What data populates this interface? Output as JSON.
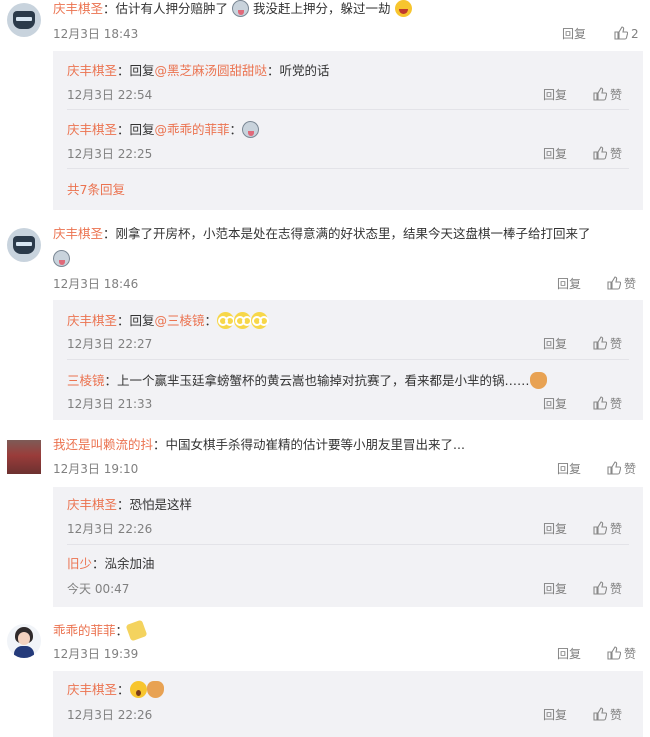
{
  "like_label": "赞",
  "reply_label": "回复",
  "comments": [
    {
      "name": "庆丰棋圣",
      "text_a": "估计有人押分赔肿了",
      "text_b": "我没赶上押分，躲过一劫",
      "time": "12月3日 18:43",
      "likes": "2",
      "replies": [
        {
          "name": "庆丰棋圣",
          "prefix": "：回复",
          "mention": "@黑芝麻汤圆甜甜哒",
          "text": "：听党的话",
          "time": "12月3日 22:54"
        },
        {
          "name": "庆丰棋圣",
          "prefix": "：回复",
          "mention": "@乖乖的菲菲",
          "text": "：",
          "time": "12月3日 22:25"
        }
      ],
      "more": "共7条回复"
    },
    {
      "name": "庆丰棋圣",
      "text": "：刚拿了开房杯，小范本是处在志得意满的好状态里，结果今天这盘棋一棒子给打回来了",
      "time": "12月3日 18:46",
      "replies": [
        {
          "name": "庆丰棋圣",
          "prefix": "：回复",
          "mention": "@三棱镜",
          "text": "：",
          "time": "12月3日 22:27"
        },
        {
          "name": "三棱镜",
          "text": "：上一个赢芈玉廷拿螃蟹杯的黄云嵩也输掉对抗赛了，看来都是小芈的锅……",
          "time": "12月3日 21:33"
        }
      ]
    },
    {
      "name": "我还是叫赖流的抖",
      "text": "：中国女棋手杀得动崔精的估计要等小朋友里冒出来了...",
      "time": "12月3日 19:10",
      "replies": [
        {
          "name": "庆丰棋圣",
          "text": "：恐怕是这样",
          "time": "12月3日 22:26"
        },
        {
          "name": "旧少",
          "text": "：泓余加油",
          "time": "今天 00:47"
        }
      ]
    },
    {
      "name": "乖乖的菲菲",
      "text": "：",
      "time": "12月3日 19:39",
      "replies": [
        {
          "name": "庆丰棋圣",
          "text": "：",
          "time": "12月3日 22:26"
        }
      ]
    }
  ]
}
